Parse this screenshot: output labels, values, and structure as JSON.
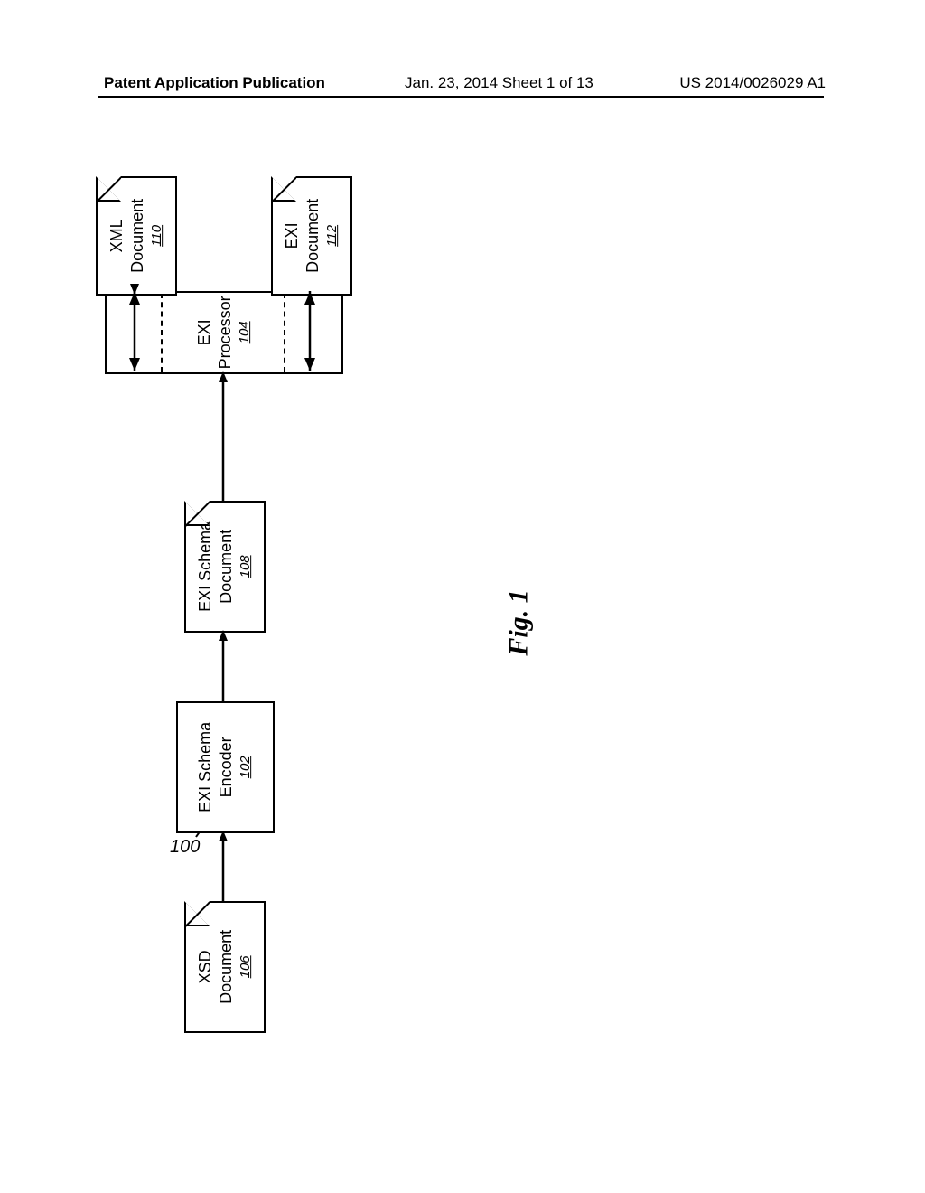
{
  "header": {
    "left": "Patent Application Publication",
    "date": "Jan. 23, 2014  Sheet 1 of 13",
    "pubnum": "US 2014/0026029 A1"
  },
  "figure_label": "Fig. 1",
  "ref_main": "100",
  "blocks": {
    "xsd": {
      "line1": "XSD",
      "line2": "Document",
      "ref": "106"
    },
    "encoder": {
      "line1": "EXI Schema",
      "line2": "Encoder",
      "ref": "102"
    },
    "exischema": {
      "line1": "EXI Schema",
      "line2": "Document",
      "ref": "108"
    },
    "processor": {
      "line1": "EXI Processor",
      "ref": "104"
    },
    "xml": {
      "line1": "XML",
      "line2": "Document",
      "ref": "110"
    },
    "exi": {
      "line1": "EXI",
      "line2": "Document",
      "ref": "112"
    }
  }
}
